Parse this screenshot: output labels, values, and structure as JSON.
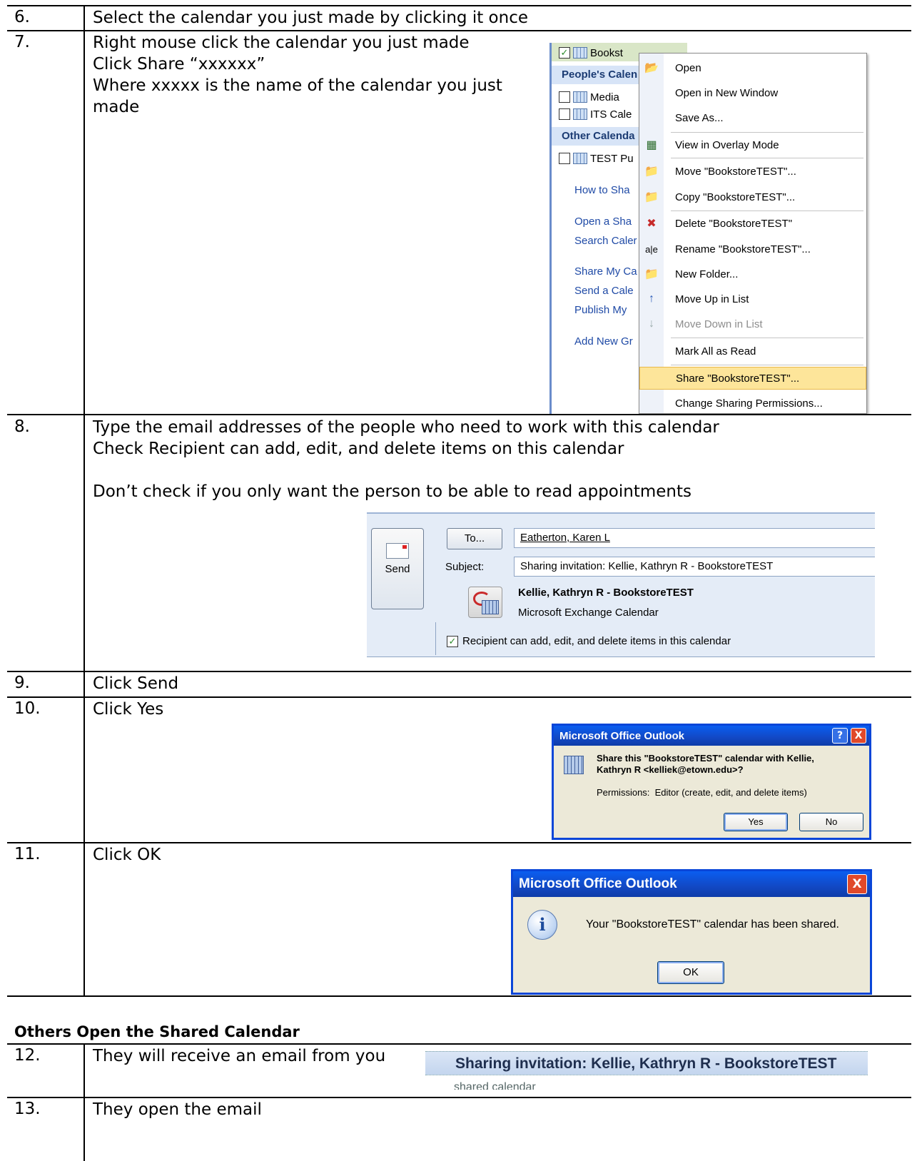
{
  "steps": [
    {
      "num": "6.",
      "lines": [
        "Select the calendar you just made by clicking it once"
      ]
    },
    {
      "num": "7.",
      "lines": [
        "Right mouse click the calendar you just made",
        "Click Share “xxxxxx”",
        "Where xxxxx is the name of the calendar you just",
        "made"
      ]
    },
    {
      "num": "8.",
      "lines": [
        "Type the email addresses of the people who need to work with this calendar",
        "Check Recipient can add, edit, and delete items on this calendar",
        "Don’t check if you only want the person to be able to read appointments"
      ]
    },
    {
      "num": "9.",
      "lines": [
        "Click Send"
      ]
    },
    {
      "num": "10.",
      "lines": [
        "Click Yes"
      ]
    },
    {
      "num": "11.",
      "lines": [
        "Click OK"
      ]
    },
    {
      "num": "12.",
      "lines": [
        "They will receive an email from you"
      ]
    },
    {
      "num": "13.",
      "lines": [
        "They open the email"
      ]
    }
  ],
  "section_heading": "Others Open the Shared Calendar",
  "context_menu_shot": {
    "selected_calendar": "Bookst",
    "groups": [
      "People's Calen",
      "Other Calenda"
    ],
    "calendars": [
      "Media",
      "ITS Cale",
      "TEST Pu"
    ],
    "links": [
      "How to Sha",
      "Open a Sha",
      "Search Caler",
      "Share My Ca",
      "Send a Cale",
      "Publish My",
      "Add New Gr"
    ],
    "menu": [
      {
        "label": "Open",
        "icon": "folder-open-icon",
        "glyph": "📂",
        "disabled": false
      },
      {
        "label": "Open in New Window",
        "icon": "",
        "glyph": "",
        "disabled": false
      },
      {
        "label": "Save As...",
        "icon": "",
        "glyph": "",
        "disabled": false
      },
      {
        "label": "View in Overlay Mode",
        "icon": "overlay-icon",
        "glyph": "▦",
        "disabled": false
      },
      {
        "label": "Move \"BookstoreTEST\"...",
        "icon": "move-icon",
        "glyph": "📁",
        "disabled": false
      },
      {
        "label": "Copy \"BookstoreTEST\"...",
        "icon": "copy-icon",
        "glyph": "📁",
        "disabled": false
      },
      {
        "label": "Delete \"BookstoreTEST\"",
        "icon": "delete-folder-icon",
        "glyph": "✖",
        "disabled": false
      },
      {
        "label": "Rename \"BookstoreTEST\"...",
        "icon": "rename-icon",
        "glyph": "a|e",
        "disabled": false
      },
      {
        "label": "New Folder...",
        "icon": "new-folder-icon",
        "glyph": "📁",
        "disabled": false
      },
      {
        "label": "Move Up in List",
        "icon": "arrow-up-icon",
        "glyph": "↑",
        "disabled": false
      },
      {
        "label": "Move Down in List",
        "icon": "arrow-down-icon",
        "glyph": "↓",
        "disabled": true
      },
      {
        "label": "Mark All as Read",
        "icon": "",
        "glyph": "",
        "disabled": false
      },
      {
        "label": "Share \"BookstoreTEST\"...",
        "icon": "",
        "glyph": "",
        "disabled": false
      },
      {
        "label": "Change Sharing Permissions...",
        "icon": "",
        "glyph": "",
        "disabled": false
      }
    ]
  },
  "share_shot": {
    "send_label": "Send",
    "to_label": "To...",
    "to_value": "Eatherton, Karen L",
    "subject_label": "Subject:",
    "subject_value": "Sharing invitation: Kellie, Kathryn R - BookstoreTEST",
    "calendar_name": "Kellie, Kathryn R - BookstoreTEST",
    "calendar_type": "Microsoft Exchange Calendar",
    "checkbox_label": "Recipient can add, edit, and delete items in this calendar",
    "checked": true
  },
  "yes_dialog": {
    "title": "Microsoft Office Outlook",
    "message_1": "Share this \"BookstoreTEST\" calendar with Kellie,",
    "message_2": "Kathryn R <kelliek@etown.edu>?",
    "permissions": "Permissions:  Editor (create, edit, and delete items)",
    "yes": "Yes",
    "no": "No",
    "help": "?",
    "close": "X"
  },
  "ok_dialog": {
    "title": "Microsoft Office Outlook",
    "message": "Your \"BookstoreTEST\" calendar has been shared.",
    "ok": "OK",
    "info": "i",
    "close": "X"
  },
  "email_strip": {
    "subject": "Sharing invitation: Kellie, Kathryn R - BookstoreTEST",
    "cut_text": "shared calendar"
  }
}
